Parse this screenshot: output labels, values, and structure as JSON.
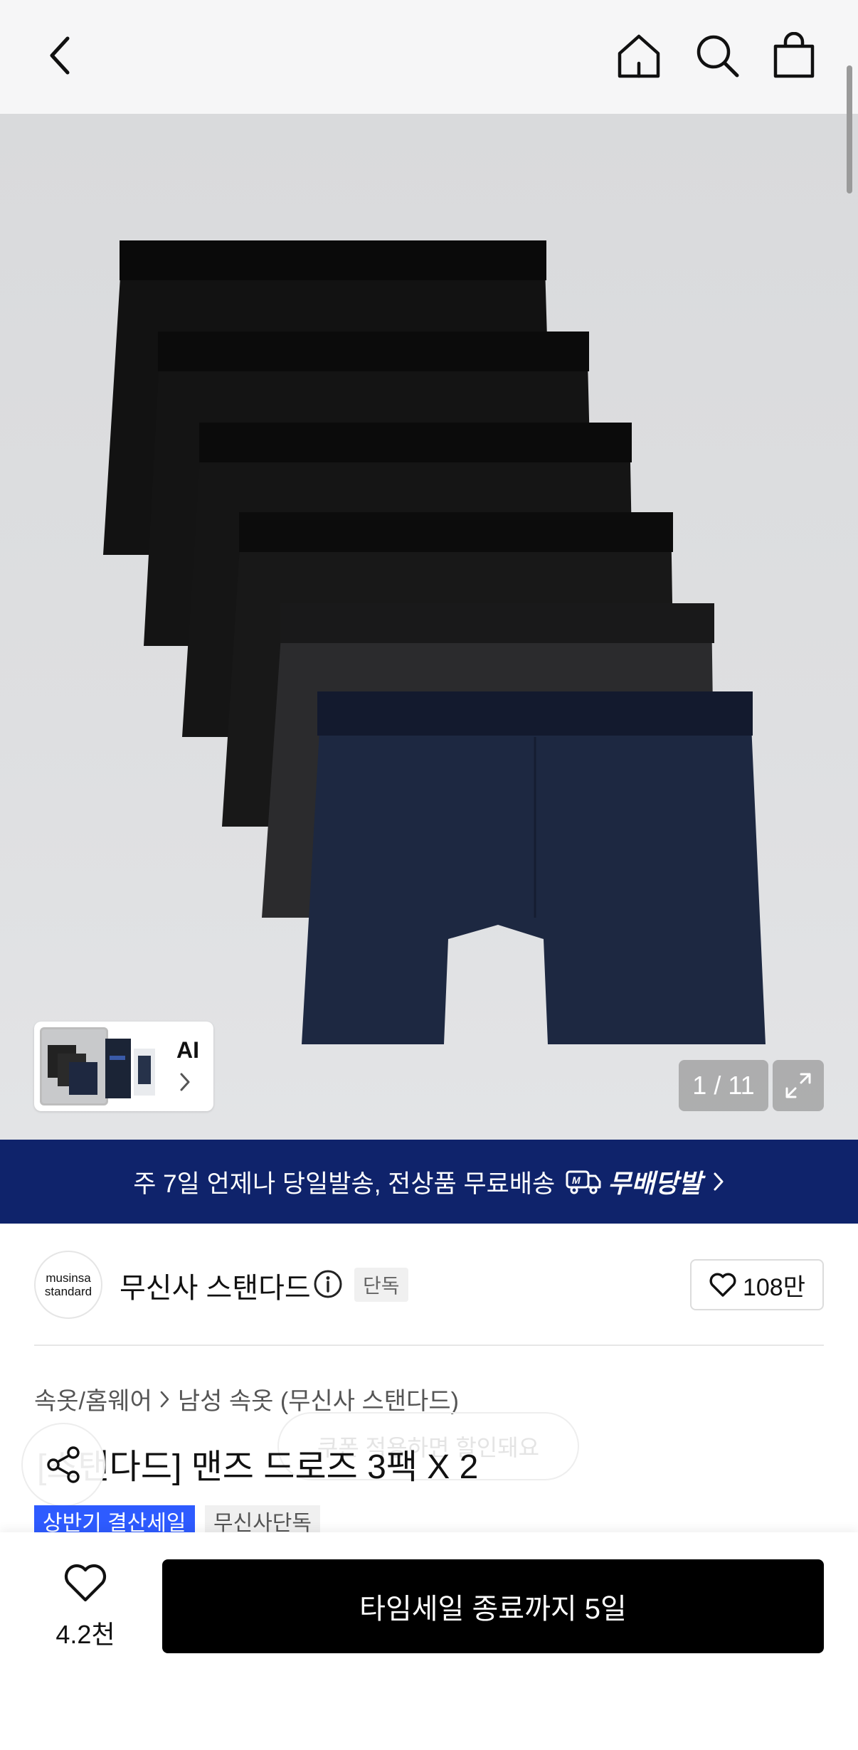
{
  "hero": {
    "counter": "1 / 11",
    "ai_label": "AI"
  },
  "shipping_banner": {
    "text": "주 7일 언제나 당일발송, 전상품 무료배송",
    "brand": "무배당발"
  },
  "brand": {
    "logo_line1": "musinsa",
    "logo_line2": "standard",
    "name": "무신사 스탠다드",
    "exclusive_tag": "단독",
    "likes": "108만"
  },
  "breadcrumb": {
    "category": "속옷/홈웨어",
    "subcategory": "남성 속옷 (무신사 스탠다드)"
  },
  "product": {
    "title": "[스탠다드] 맨즈 드로즈 3팩 X 2",
    "tag_sale": "상반기 결산세일",
    "tag_exclusive": "무신사단독",
    "faded_pill": "쿠폰 적용하면 할인돼요"
  },
  "bottom": {
    "wish_count": "4.2천",
    "cta_label": "타임세일 종료까지 5일"
  },
  "colors": {
    "banner": "#0f236b",
    "sale_tag": "#2e5bff",
    "cta": "#000000"
  }
}
